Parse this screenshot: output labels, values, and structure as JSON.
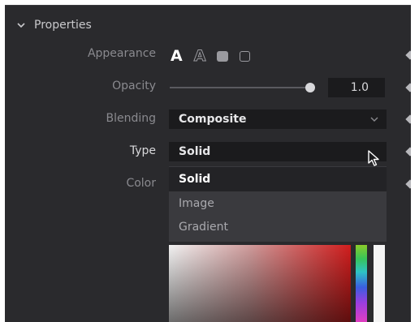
{
  "section": {
    "title": "Properties"
  },
  "appearance": {
    "label": "Appearance",
    "options": [
      {
        "icon": "text-solid-icon",
        "glyph": "A",
        "active": true
      },
      {
        "icon": "text-outline-icon",
        "glyph": "A",
        "active": false
      },
      {
        "icon": "rounded-box-solid-icon",
        "active": false
      },
      {
        "icon": "rounded-box-outline-icon",
        "active": false
      }
    ]
  },
  "opacity": {
    "label": "Opacity",
    "value": "1.0",
    "level": 1.0
  },
  "blending": {
    "label": "Blending",
    "value": "Composite"
  },
  "type": {
    "label": "Type",
    "value": "Solid"
  },
  "color": {
    "label": "Color"
  },
  "type_menu": {
    "items": [
      {
        "label": "Solid",
        "selected": true
      },
      {
        "label": "Image",
        "selected": false
      },
      {
        "label": "Gradient",
        "selected": false
      }
    ]
  },
  "colors": {
    "panel_bg": "#2a2a2d",
    "field_bg": "#1b1b1d",
    "menu_bg": "#3a3a3e",
    "hue_accent": "#d11d1d"
  }
}
